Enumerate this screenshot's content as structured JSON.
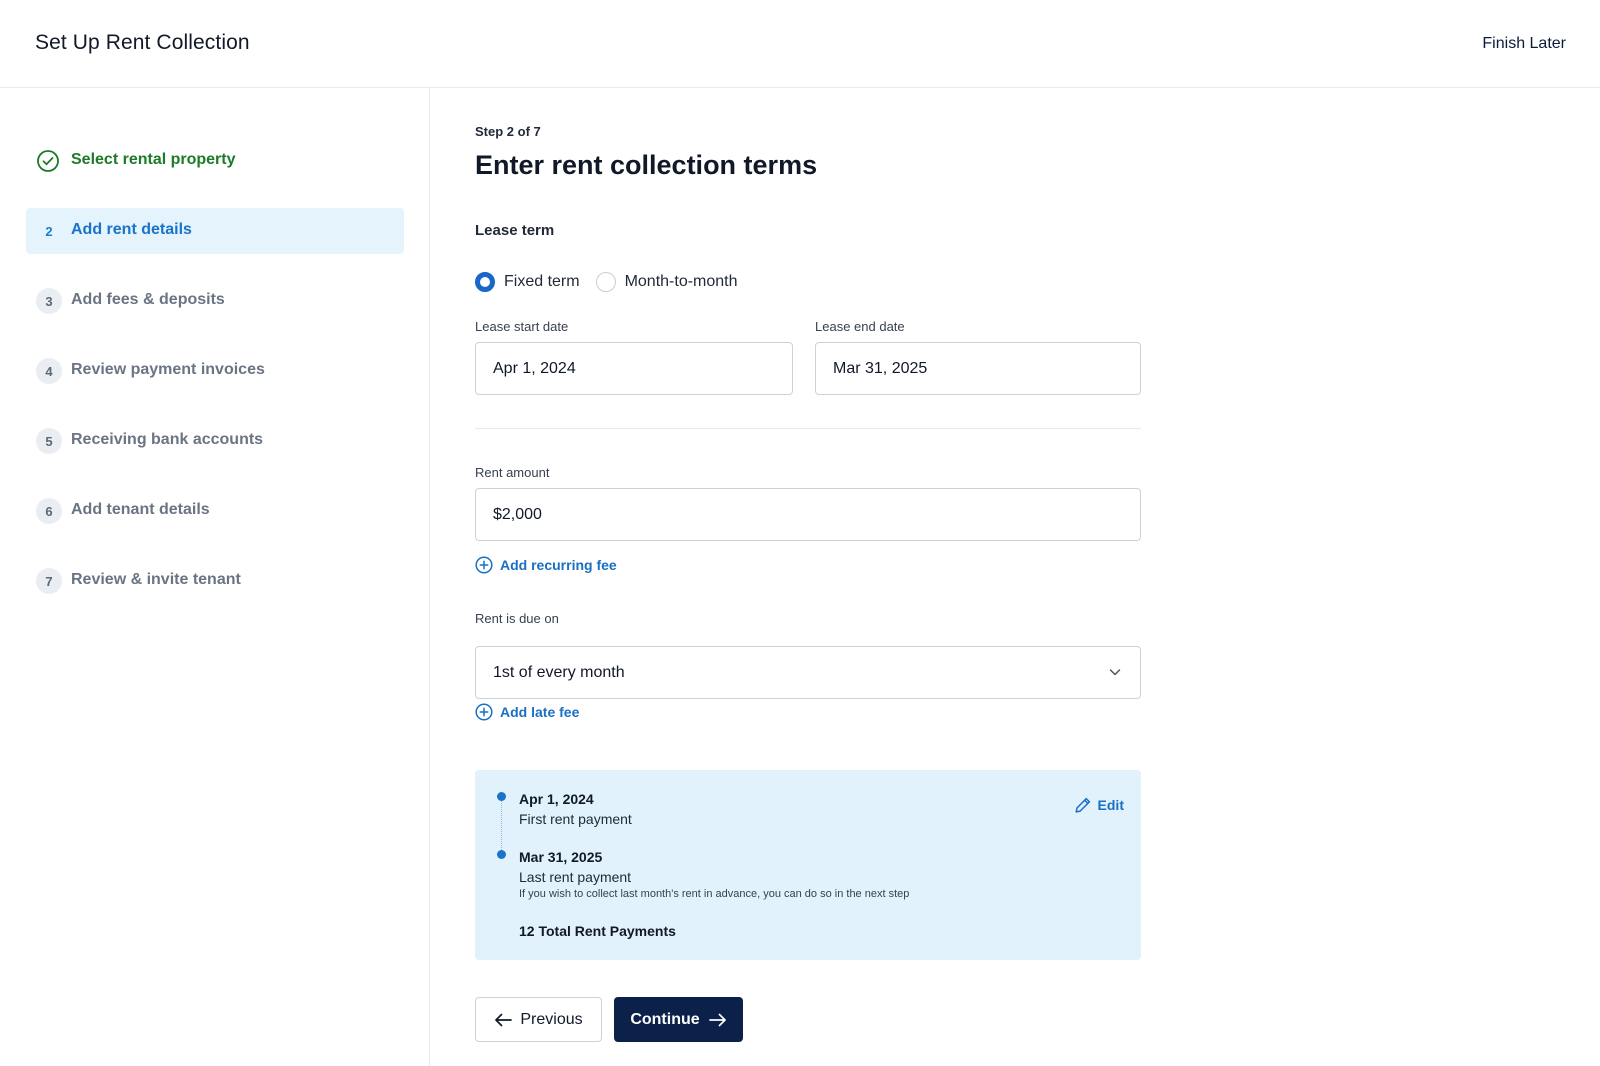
{
  "header": {
    "title": "Set Up Rent Collection",
    "finish_later": "Finish Later"
  },
  "sidebar": {
    "steps": [
      {
        "number": "",
        "label": "Select rental property",
        "state": "done"
      },
      {
        "number": "2",
        "label": "Add rent details",
        "state": "active"
      },
      {
        "number": "3",
        "label": "Add fees & deposits",
        "state": "pending"
      },
      {
        "number": "4",
        "label": "Review payment invoices",
        "state": "pending"
      },
      {
        "number": "5",
        "label": "Receiving bank accounts",
        "state": "pending"
      },
      {
        "number": "6",
        "label": "Add tenant details",
        "state": "pending"
      },
      {
        "number": "7",
        "label": "Review & invite tenant",
        "state": "pending"
      }
    ]
  },
  "main": {
    "step_counter": "Step 2 of 7",
    "title": "Enter rent collection terms",
    "lease_term": {
      "label": "Lease term",
      "options": [
        "Fixed term",
        "Month-to-month"
      ],
      "selected": "Fixed term"
    },
    "lease_start": {
      "label": "Lease start date",
      "value": "Apr 1, 2024"
    },
    "lease_end": {
      "label": "Lease end date",
      "value": "Mar 31, 2025"
    },
    "rent_amount": {
      "label": "Rent amount",
      "value": "$2,000"
    },
    "add_recurring_fee": "Add recurring fee",
    "due_on": {
      "label": "Rent is due on",
      "value": "1st of every month"
    },
    "add_late_fee": "Add late fee",
    "summary": {
      "first_date": "Apr 1, 2024",
      "first_desc": "First rent payment",
      "last_date": "Mar 31, 2025",
      "last_desc": "Last rent payment",
      "note": "If you wish to collect last month's rent in advance, you can do so in the next step",
      "total": "12 Total Rent Payments",
      "edit": "Edit"
    },
    "buttons": {
      "previous": "Previous",
      "continue": "Continue"
    }
  },
  "colors": {
    "accent_blue": "#1a73c8",
    "done_green": "#1d7a28",
    "primary_button": "#0b2149",
    "summary_bg": "#e1f2fc",
    "active_step_bg": "#e4f3fc"
  }
}
